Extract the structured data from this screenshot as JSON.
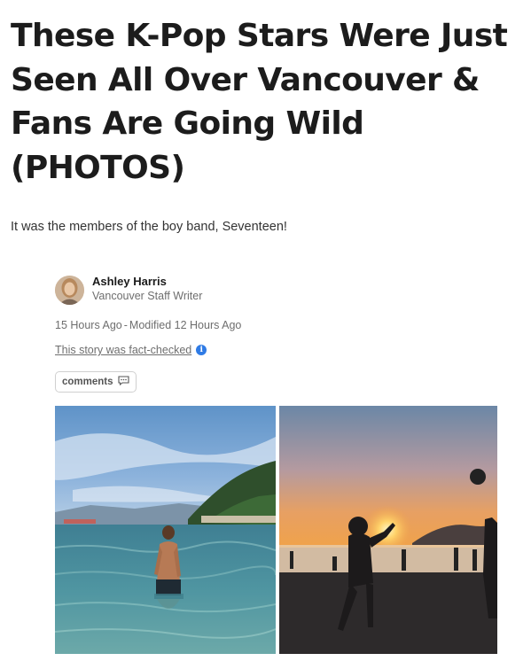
{
  "article": {
    "headline": "These K-Pop Stars Were Just Seen All Over Vancouver & Fans Are Going Wild (PHOTOS)",
    "subheadline": "It was the members of the boy band, Seventeen!"
  },
  "author": {
    "name": "Ashley Harris",
    "role": "Vancouver Staff Writer",
    "avatar_icon": "author-avatar"
  },
  "meta": {
    "published": "15 Hours Ago",
    "separator": "-",
    "modified": "Modified 12 Hours Ago",
    "fact_check_label": "This story was fact-checked",
    "info_icon": "info-icon"
  },
  "comments": {
    "label": "comments",
    "icon": "comment-bubble-icon"
  },
  "photos": {
    "left_icon": "man-in-ocean-photo",
    "right_icon": "beach-volleyball-sunset-photo"
  }
}
